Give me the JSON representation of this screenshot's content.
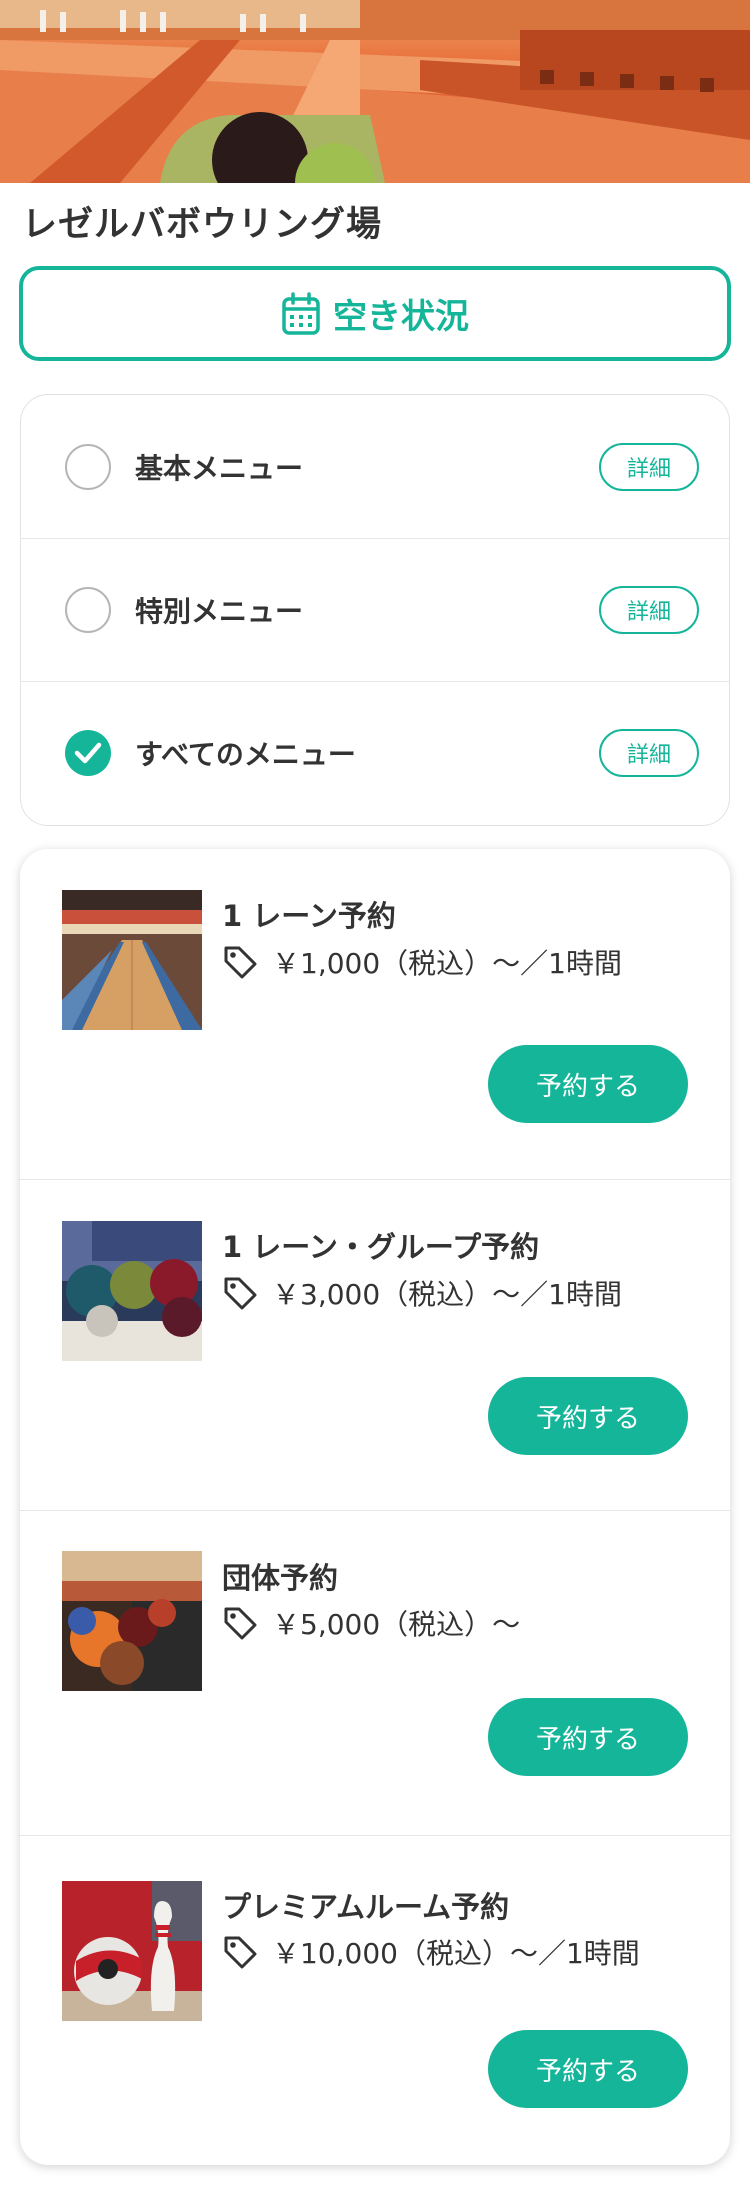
{
  "venue": {
    "name": "レゼルバボウリング場"
  },
  "availability": {
    "label": "空き状況",
    "icon": "calendar-icon"
  },
  "filters": [
    {
      "label": "基本メニュー",
      "checked": false,
      "detail_label": "詳細"
    },
    {
      "label": "特別メニュー",
      "checked": false,
      "detail_label": "詳細"
    },
    {
      "label": "すべてのメニュー",
      "checked": true,
      "detail_label": "詳細"
    }
  ],
  "plans": [
    {
      "title": "1 レーン予約",
      "price": "￥1,000（税込）〜／1時間",
      "button": "予約する"
    },
    {
      "title": "1 レーン・グループ予約",
      "price": "￥3,000（税込）〜／1時間",
      "button": "予約する"
    },
    {
      "title": "団体予約",
      "price": "￥5,000（税込）〜",
      "button": "予約する"
    },
    {
      "title": "プレミアムルーム予約",
      "price": "￥10,000（税込）〜／1時間",
      "button": "予約する"
    }
  ],
  "colors": {
    "accent": "#15b59a",
    "text": "#333333",
    "border": "#e2e2e2"
  }
}
